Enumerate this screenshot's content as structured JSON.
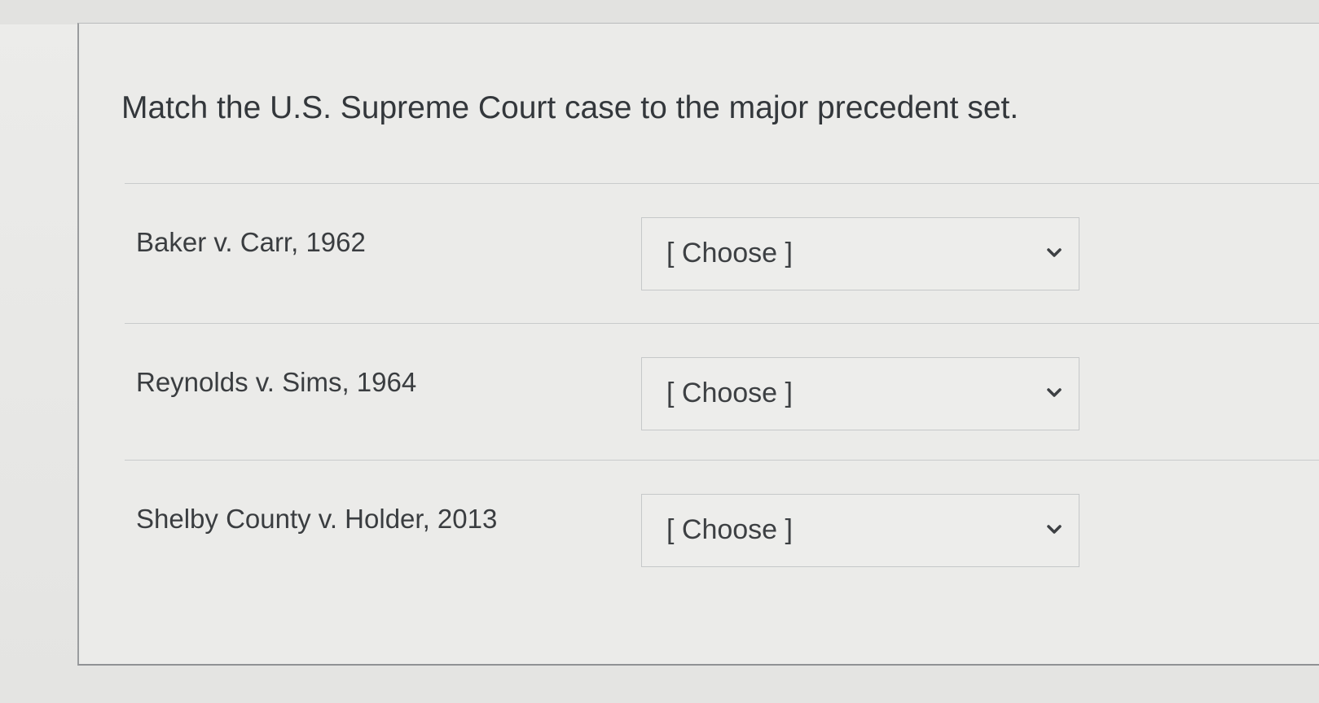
{
  "question": {
    "title": "Match the U.S. Supreme Court case to the major precedent set."
  },
  "rows": [
    {
      "case": "Baker v. Carr, 1962",
      "select_value": "[ Choose ]",
      "icon": "chevron-down-icon"
    },
    {
      "case": "Reynolds v. Sims, 1964",
      "select_value": "[ Choose ]",
      "icon": "chevron-down-icon"
    },
    {
      "case": "Shelby County v. Holder, 2013",
      "select_value": "[ Choose ]",
      "icon": "chevron-down-icon"
    }
  ]
}
